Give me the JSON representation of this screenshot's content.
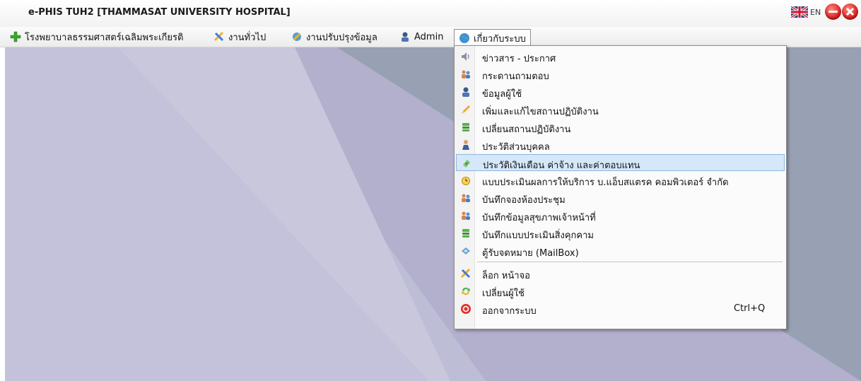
{
  "window": {
    "title": "e-PHIS TUH2 [THAMMASAT UNIVERSITY HOSPITAL]",
    "language": "EN"
  },
  "menubar": {
    "items": [
      {
        "label": "โรงพยาบาลธรรมศาสตร์เฉลิมพระเกียรติ",
        "icon": "green-plus-icon"
      },
      {
        "label": "งานทั่วไป",
        "icon": "tools-icon"
      },
      {
        "label": "งานปรับปรุงข้อมูล",
        "icon": "edit-data-icon"
      },
      {
        "label": "Admin",
        "icon": "admin-user-icon"
      },
      {
        "label": "เกี่ยวกับระบบ",
        "icon": "globe-icon"
      }
    ]
  },
  "dropdown": {
    "items": [
      {
        "label": "ข่าวสาร - ประกาศ",
        "icon": "speaker-icon"
      },
      {
        "label": "กระดานถามตอบ",
        "icon": "users-icon"
      },
      {
        "label": "ข้อมูลผู้ใช้",
        "icon": "user-icon"
      },
      {
        "label": "เพิ่มและแก้ไขสถานปฏิบัติงาน",
        "icon": "pencil-icon"
      },
      {
        "label": "เปลี่ยนสถานปฏิบัติงาน",
        "icon": "stack-icon"
      },
      {
        "label": "ประวัติส่วนบุคคล",
        "icon": "person-icon"
      },
      {
        "label": "ประวัติเงินเดือน ค่าจ้าง และค่าตอบแทน",
        "icon": "money-icon"
      },
      {
        "label": "แบบประเมินผลการให้บริการ บ.แอ็บสแตรค คอมพิวเตอร์ จำกัด",
        "icon": "alarm-clock-icon"
      },
      {
        "label": "บันทึกจองห้องประชุม",
        "icon": "users-icon"
      },
      {
        "label": "บันทึกข้อมูลสุขภาพเจ้าหน้าที่",
        "icon": "users-icon"
      },
      {
        "label": "บันทึกแบบประเมินสิ่งคุกคาม",
        "icon": "stack-icon"
      },
      {
        "label": "ตู้รับจดหมาย (MailBox)",
        "icon": "mailbox-icon"
      },
      {
        "label": "ล็อก หน้าจอ",
        "icon": "lock-tools-icon"
      },
      {
        "label": "เปลี่ยนผู้ใช้",
        "icon": "switch-user-icon"
      },
      {
        "label": "ออกจากระบบ",
        "icon": "exit-icon",
        "shortcut": "Ctrl+Q"
      }
    ]
  },
  "colors": {
    "highlight": "#d5e7f8",
    "desktop": "#8f98ab"
  }
}
